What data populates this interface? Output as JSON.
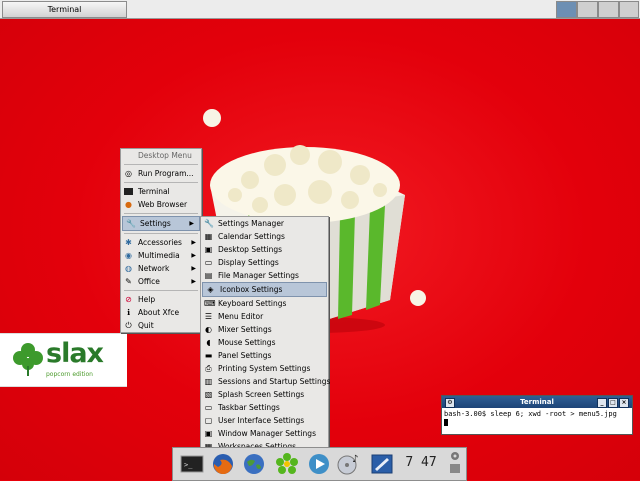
{
  "taskbar": {
    "window_button": "Terminal"
  },
  "workspaces": {
    "count": 4,
    "active_index": 0
  },
  "logo": {
    "word": "slax",
    "subtitle": "popcorn edition"
  },
  "main_menu": {
    "header": "Desktop Menu",
    "items": [
      {
        "label": "Run Program...",
        "icon": "run-icon"
      },
      {
        "label": "Terminal",
        "icon": "terminal-icon"
      },
      {
        "label": "Web Browser",
        "icon": "browser-icon"
      },
      {
        "label": "Settings",
        "icon": "wrench-icon",
        "submenu": true,
        "selected": true
      },
      {
        "label": "Accessories",
        "icon": "accessories-icon",
        "submenu": true
      },
      {
        "label": "Multimedia",
        "icon": "multimedia-icon",
        "submenu": true
      },
      {
        "label": "Network",
        "icon": "network-icon",
        "submenu": true
      },
      {
        "label": "Office",
        "icon": "office-icon",
        "submenu": true
      },
      {
        "label": "Help",
        "icon": "help-icon"
      },
      {
        "label": "About Xfce",
        "icon": "info-icon"
      },
      {
        "label": "Quit",
        "icon": "quit-icon"
      }
    ]
  },
  "settings_menu": {
    "items": [
      "Settings Manager",
      "Calendar Settings",
      "Desktop Settings",
      "Display Settings",
      "File Manager Settings",
      "Iconbox Settings",
      "Keyboard Settings",
      "Menu Editor",
      "Mixer Settings",
      "Mouse Settings",
      "Panel Settings",
      "Printing System Settings",
      "Sessions and Startup Settings",
      "Splash Screen Settings",
      "Taskbar Settings",
      "User Interface Settings",
      "Window Manager Settings",
      "Workspaces Settings"
    ],
    "selected_index": 5
  },
  "terminal": {
    "title": "Terminal",
    "prompt": "bash-3.00$ sleep 6; xwd -root > menu5.jpg"
  },
  "panel": {
    "clock": "7 47",
    "launchers": [
      "terminal-launcher",
      "firefox-launcher",
      "globe-launcher",
      "icq-launcher",
      "media-player-launcher",
      "audio-launcher",
      "editor-launcher"
    ]
  },
  "colors": {
    "desktop": "#e3000b",
    "selection": "#b8c6d8",
    "menu_bg": "#e9e8e6",
    "slax_green": "#2a7a2a"
  }
}
